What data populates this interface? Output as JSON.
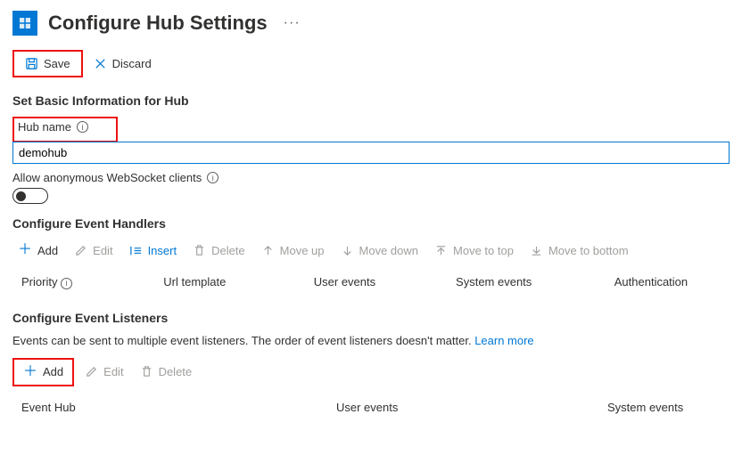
{
  "header": {
    "title": "Configure Hub Settings"
  },
  "toolbar": {
    "save": "Save",
    "discard": "Discard"
  },
  "basic": {
    "section_title": "Set Basic Information for Hub",
    "hubname_label": "Hub name",
    "hubname_value": "demohub",
    "anon_label": "Allow anonymous WebSocket clients"
  },
  "handlers": {
    "section_title": "Configure Event Handlers",
    "cmds": {
      "add": "Add",
      "edit": "Edit",
      "insert": "Insert",
      "delete": "Delete",
      "moveup": "Move up",
      "movedown": "Move down",
      "movetop": "Move to top",
      "movebottom": "Move to bottom"
    },
    "cols": {
      "priority": "Priority",
      "url": "Url template",
      "user": "User events",
      "system": "System events",
      "auth": "Authentication"
    }
  },
  "listeners": {
    "section_title": "Configure Event Listeners",
    "desc": "Events can be sent to multiple event listeners. The order of event listeners doesn't matter. ",
    "learn": "Learn more",
    "cmds": {
      "add": "Add",
      "edit": "Edit",
      "delete": "Delete"
    },
    "cols": {
      "hub": "Event Hub",
      "user": "User events",
      "system": "System events"
    }
  }
}
